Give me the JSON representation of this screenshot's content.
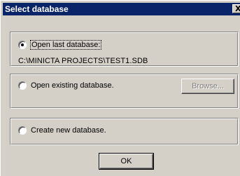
{
  "window": {
    "title": "Select database",
    "close_glyph": "X"
  },
  "options": {
    "open_last": {
      "label": "Open last database:",
      "selected": true,
      "path": "C:\\MINICTA PROJECTS\\TEST1.SDB"
    },
    "open_existing": {
      "label": "Open existing database.",
      "selected": false,
      "browse_label": "Browse...",
      "browse_enabled": false
    },
    "create_new": {
      "label": "Create new database.",
      "selected": false
    }
  },
  "footer": {
    "ok_label": "OK"
  },
  "colors": {
    "titlebar": "#0a246a",
    "face": "#d4d0c8",
    "disabled_text": "#808080"
  }
}
